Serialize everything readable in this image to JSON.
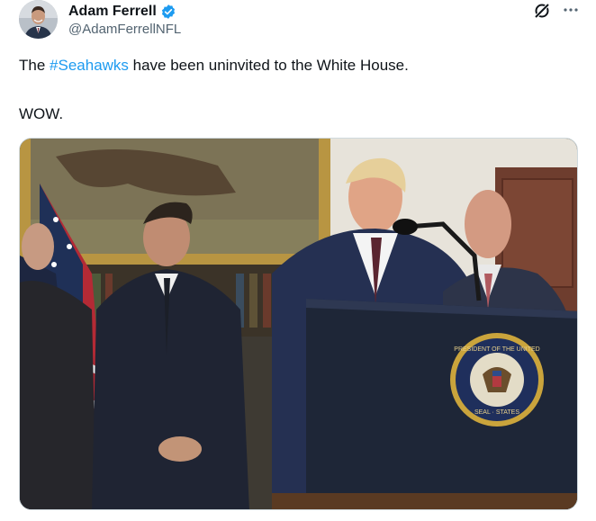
{
  "author": {
    "display_name": "Adam Ferrell",
    "handle": "@AdamFerrellNFL",
    "verified": true,
    "avatar_icon": "avatar"
  },
  "header_actions": {
    "grok_icon": "grok-icon",
    "more_icon": "more-icon"
  },
  "tweet": {
    "line1_before": "The ",
    "line1_hashtag": "#Seahawks",
    "line1_after": " have been uninvited to the White House.",
    "line2": "WOW."
  },
  "colors": {
    "link": "#1d9bf0",
    "verified_badge": "#1d9bf0",
    "secondary_text": "#536471"
  },
  "media": {
    "seal_text_top": "PRESIDENT OF THE UNITED",
    "seal_text_bottom": "SEAL · STATES"
  }
}
